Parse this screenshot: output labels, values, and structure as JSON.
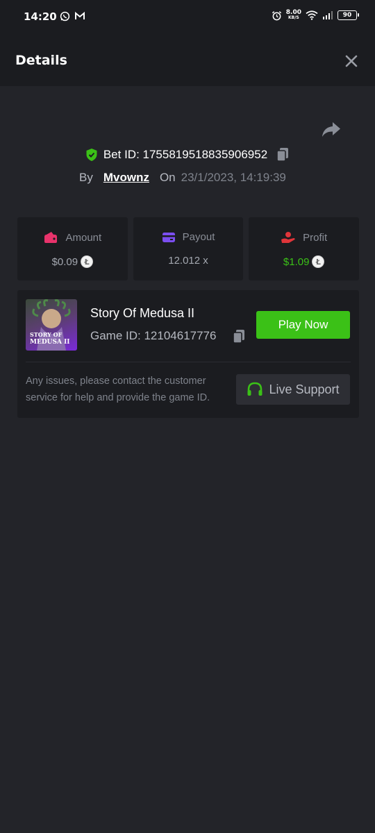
{
  "status_bar": {
    "time": "14:20",
    "net_speed_value": "8.00",
    "net_speed_unit": "KB/S",
    "battery": "90"
  },
  "header": {
    "title": "Details",
    "close_icon": "close-icon"
  },
  "bet": {
    "id_text": "Bet ID: 1755819518835906952",
    "by_label": "By",
    "user": "Mvownz",
    "on_label": "On",
    "date": "23/1/2023, 14:19:39"
  },
  "stats": [
    {
      "label": "Amount",
      "value": "$0.09",
      "icon": "wallet-icon",
      "icon_color": "#e8336b",
      "value_color": "#a4a8b0",
      "coin": true
    },
    {
      "label": "Payout",
      "value": "12.012 x",
      "icon": "card-icon",
      "icon_color": "#7b4ef0",
      "value_color": "#a4a8b0",
      "coin": false
    },
    {
      "label": "Profit",
      "value": "$1.09",
      "icon": "hand-coin-icon",
      "icon_color": "#e0353a",
      "value_color": "#3bc117",
      "coin": true
    }
  ],
  "game": {
    "thumb_line1": "STORY OF",
    "thumb_line2": "MEDUSA II",
    "name": "Story Of Medusa II",
    "id_text": "Game ID: 12104617776",
    "play_label": "Play Now",
    "notice": "Any issues, please contact the customer service for help and provide the game ID.",
    "support_label": "Live Support"
  },
  "colors": {
    "accent_green": "#3bc117",
    "panel": "#1b1c20",
    "background": "#232429"
  }
}
